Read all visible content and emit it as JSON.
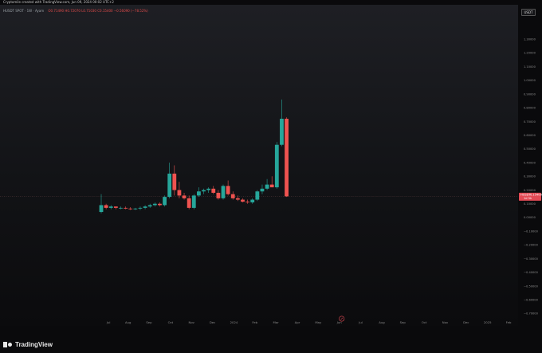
{
  "caption": "Cryptomile created with TradingView.com, Jun 09, 2024 00:02 UTC+2",
  "legend": {
    "symbol": "HUSDT SPOT · 1W · Ayam",
    "ohlc": "O0.71490 H0.72070 L0.71030 C0.15400 −0.56090 (−78.52%)"
  },
  "currency_button": "USDT",
  "brand": "TradingView",
  "last_price": {
    "label": "HUSDT",
    "value": "0.15400",
    "sub": "1d 5h"
  },
  "colors": {
    "up": "#26a69a",
    "down": "#ef5350",
    "accent": "#e24a55"
  },
  "chart_data": {
    "type": "candlestick",
    "title": "",
    "xlabel": "",
    "ylabel": "",
    "ylim": [
      -0.75,
      1.4
    ],
    "y_ticks": [
      "1.30000",
      "1.20000",
      "1.10000",
      "1.00000",
      "0.90000",
      "0.80000",
      "0.70000",
      "0.60000",
      "0.50000",
      "0.40000",
      "0.30000",
      "0.20000",
      "0.10000",
      "0.00000",
      "−0.10000",
      "−0.20000",
      "−0.30000",
      "−0.40000",
      "−0.50000",
      "−0.60000",
      "−0.70000"
    ],
    "y_tick_values": [
      1.3,
      1.2,
      1.1,
      1.0,
      0.9,
      0.8,
      0.7,
      0.6,
      0.5,
      0.4,
      0.3,
      0.2,
      0.1,
      0.0,
      -0.1,
      -0.2,
      -0.3,
      -0.4,
      -0.5,
      -0.6,
      -0.7
    ],
    "x_ticks": [
      "Jul",
      "Aug",
      "Sep",
      "Oct",
      "Nov",
      "Dec",
      "2024",
      "Feb",
      "Mar",
      "Apr",
      "May",
      "Jun",
      "Jul",
      "Aug",
      "Sep",
      "Oct",
      "Nov",
      "Dec",
      "2025",
      "Feb"
    ],
    "x_tick_weeks": [
      1.5,
      5.5,
      9.8,
      14.2,
      18.5,
      22.8,
      27.2,
      31.5,
      35.8,
      40.2,
      44.5,
      48.8,
      53.2,
      57.5,
      61.8,
      66.2,
      70.5,
      74.8,
      79.2,
      83.5
    ],
    "grid": false,
    "candles": [
      {
        "o": 0.04,
        "h": 0.17,
        "l": 0.03,
        "c": 0.09
      },
      {
        "o": 0.09,
        "h": 0.1,
        "l": 0.06,
        "c": 0.07
      },
      {
        "o": 0.07,
        "h": 0.09,
        "l": 0.06,
        "c": 0.08
      },
      {
        "o": 0.08,
        "h": 0.08,
        "l": 0.06,
        "c": 0.07
      },
      {
        "o": 0.07,
        "h": 0.08,
        "l": 0.06,
        "c": 0.07
      },
      {
        "o": 0.07,
        "h": 0.08,
        "l": 0.06,
        "c": 0.065
      },
      {
        "o": 0.065,
        "h": 0.075,
        "l": 0.055,
        "c": 0.06
      },
      {
        "o": 0.06,
        "h": 0.07,
        "l": 0.055,
        "c": 0.065
      },
      {
        "o": 0.065,
        "h": 0.08,
        "l": 0.055,
        "c": 0.07
      },
      {
        "o": 0.07,
        "h": 0.09,
        "l": 0.06,
        "c": 0.08
      },
      {
        "o": 0.08,
        "h": 0.1,
        "l": 0.07,
        "c": 0.09
      },
      {
        "o": 0.09,
        "h": 0.11,
        "l": 0.08,
        "c": 0.1
      },
      {
        "o": 0.1,
        "h": 0.11,
        "l": 0.08,
        "c": 0.09
      },
      {
        "o": 0.09,
        "h": 0.16,
        "l": 0.08,
        "c": 0.15
      },
      {
        "o": 0.15,
        "h": 0.4,
        "l": 0.14,
        "c": 0.32
      },
      {
        "o": 0.32,
        "h": 0.38,
        "l": 0.16,
        "c": 0.2
      },
      {
        "o": 0.2,
        "h": 0.26,
        "l": 0.14,
        "c": 0.16
      },
      {
        "o": 0.16,
        "h": 0.18,
        "l": 0.13,
        "c": 0.14
      },
      {
        "o": 0.14,
        "h": 0.16,
        "l": 0.06,
        "c": 0.07
      },
      {
        "o": 0.07,
        "h": 0.17,
        "l": 0.06,
        "c": 0.16
      },
      {
        "o": 0.16,
        "h": 0.22,
        "l": 0.15,
        "c": 0.19
      },
      {
        "o": 0.19,
        "h": 0.21,
        "l": 0.17,
        "c": 0.2
      },
      {
        "o": 0.2,
        "h": 0.22,
        "l": 0.18,
        "c": 0.21
      },
      {
        "o": 0.21,
        "h": 0.23,
        "l": 0.17,
        "c": 0.18
      },
      {
        "o": 0.18,
        "h": 0.2,
        "l": 0.13,
        "c": 0.14
      },
      {
        "o": 0.14,
        "h": 0.24,
        "l": 0.13,
        "c": 0.23
      },
      {
        "o": 0.23,
        "h": 0.27,
        "l": 0.16,
        "c": 0.17
      },
      {
        "o": 0.17,
        "h": 0.19,
        "l": 0.13,
        "c": 0.14
      },
      {
        "o": 0.14,
        "h": 0.16,
        "l": 0.12,
        "c": 0.13
      },
      {
        "o": 0.13,
        "h": 0.14,
        "l": 0.11,
        "c": 0.115
      },
      {
        "o": 0.115,
        "h": 0.13,
        "l": 0.1,
        "c": 0.11
      },
      {
        "o": 0.11,
        "h": 0.14,
        "l": 0.1,
        "c": 0.13
      },
      {
        "o": 0.13,
        "h": 0.2,
        "l": 0.12,
        "c": 0.19
      },
      {
        "o": 0.19,
        "h": 0.24,
        "l": 0.17,
        "c": 0.21
      },
      {
        "o": 0.21,
        "h": 0.28,
        "l": 0.2,
        "c": 0.24
      },
      {
        "o": 0.24,
        "h": 0.3,
        "l": 0.22,
        "c": 0.22
      },
      {
        "o": 0.22,
        "h": 0.55,
        "l": 0.21,
        "c": 0.53
      },
      {
        "o": 0.53,
        "h": 0.86,
        "l": 0.52,
        "c": 0.72
      },
      {
        "o": 0.72,
        "h": 0.73,
        "l": 0.15,
        "c": 0.154
      }
    ]
  }
}
